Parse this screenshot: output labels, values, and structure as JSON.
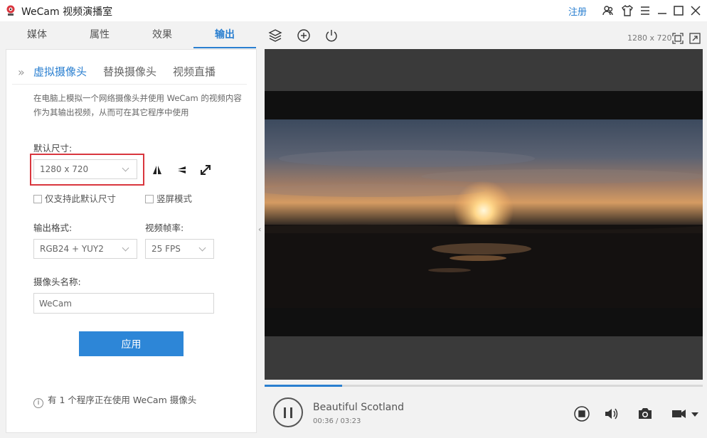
{
  "app": {
    "title": "WeCam 视频演播室",
    "register": "注册"
  },
  "nav": {
    "tabs": [
      "媒体",
      "属性",
      "效果",
      "输出"
    ],
    "active_index": 3
  },
  "preview": {
    "resolution": "1280 x 720"
  },
  "output_panel": {
    "subtabs": [
      "虚拟摄像头",
      "替换摄像头",
      "视频直播"
    ],
    "active_subtab": 0,
    "description": "在电脑上模拟一个网络摄像头并使用 WeCam 的视频内容作为其输出视频，从而可在其它程序中使用",
    "default_size_label": "默认尺寸:",
    "default_size_value": "1280 x 720",
    "only_default_size_label": "仅支持此默认尺寸",
    "portrait_mode_label": "竖屏模式",
    "output_format_label": "输出格式:",
    "output_format_value": "RGB24 + YUY2",
    "frame_rate_label": "视频帧率:",
    "frame_rate_value": "25 FPS",
    "camera_name_label": "摄像头名称:",
    "camera_name_value": "WeCam",
    "apply_label": "应用",
    "status_text": "有 1 个程序正在使用 WeCam 摄像头"
  },
  "player": {
    "title": "Beautiful Scotland",
    "time": "00:36 / 03:23",
    "progress": 0.177
  },
  "icons": {
    "titlebar": [
      "users-icon",
      "shirt-icon",
      "menu-icon",
      "minimize-icon",
      "maximize-icon",
      "close-icon"
    ],
    "toolbar": [
      "layers-icon",
      "add-circle-icon",
      "power-icon"
    ]
  },
  "colors": {
    "accent": "#2a7fd0",
    "apply_button": "#2d86d7",
    "highlight": "#d9363e"
  }
}
